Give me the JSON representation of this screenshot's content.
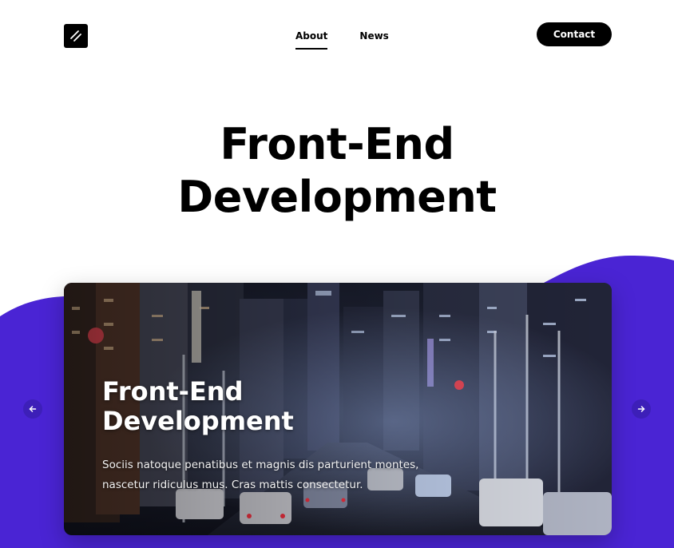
{
  "header": {
    "logo_icon": "slash-logo-icon",
    "nav": [
      {
        "label": "About",
        "active": true
      },
      {
        "label": "News",
        "active": false
      }
    ],
    "contact_label": "Contact"
  },
  "hero": {
    "title_line1": "Front-End",
    "title_line2": "Development"
  },
  "carousel": {
    "slide": {
      "title_line1": "Front-End",
      "title_line2": "Development",
      "text_line1": "Sociis natoque penatibus et magnis dis parturient montes,",
      "text_line2": "nascetur ridiculus mus. Cras mattis consectetur.",
      "image": "night-city-street-photo"
    },
    "prev_icon": "arrow-left-icon",
    "next_icon": "arrow-right-icon"
  },
  "colors": {
    "accent": "#4a24d4",
    "arrow_bg": "#3d1fb8",
    "text": "#000000"
  }
}
